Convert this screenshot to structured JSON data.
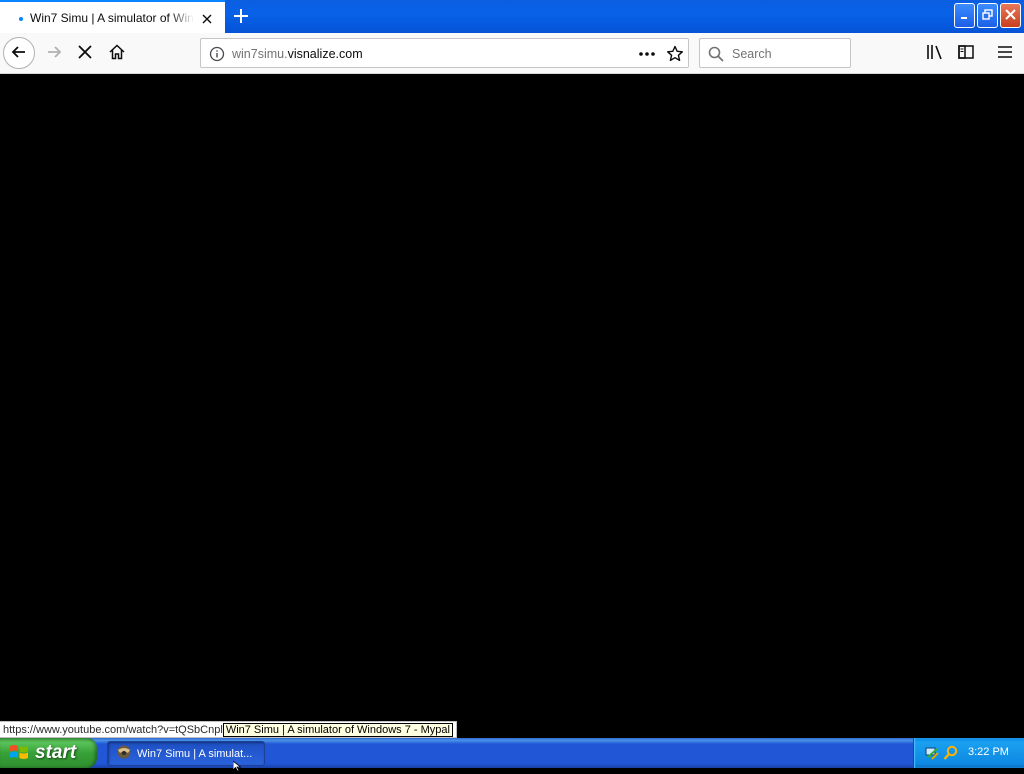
{
  "browser": {
    "tab": {
      "title": "Win7 Simu | A simulator of Windows 7 - Mypal",
      "close_icon": "close-icon"
    },
    "new_tab_icon": "plus-icon",
    "window_controls": [
      "minimize-icon",
      "restore-icon",
      "close-icon"
    ],
    "nav": {
      "back_icon": "arrow-left-icon",
      "forward_icon": "arrow-right-icon",
      "stop_icon": "stop-x-icon",
      "home_icon": "home-icon"
    },
    "urlbar": {
      "prefix": "win7simu.",
      "host": "visnalize.com"
    },
    "search": {
      "placeholder": "Search"
    },
    "toolbar_icons": [
      "library-icon",
      "sidebar-icon",
      "hamburger-menu-icon"
    ]
  },
  "status": {
    "link": "https://www.youtube.com/watch?v=tQSbCnpl",
    "tooltip": "Win7 Simu | A simulator of Windows 7 - Mypal"
  },
  "taskbar": {
    "start_label": "start",
    "task_label": "Win7 Simu | A simulat...",
    "clock": "3:22 PM"
  },
  "colors": {
    "tab_accent": "#0a84ff",
    "titlebar": "#0862e8",
    "taskbar": "#2157d7",
    "start_button": "#37a137",
    "content_bg": "#000000"
  }
}
